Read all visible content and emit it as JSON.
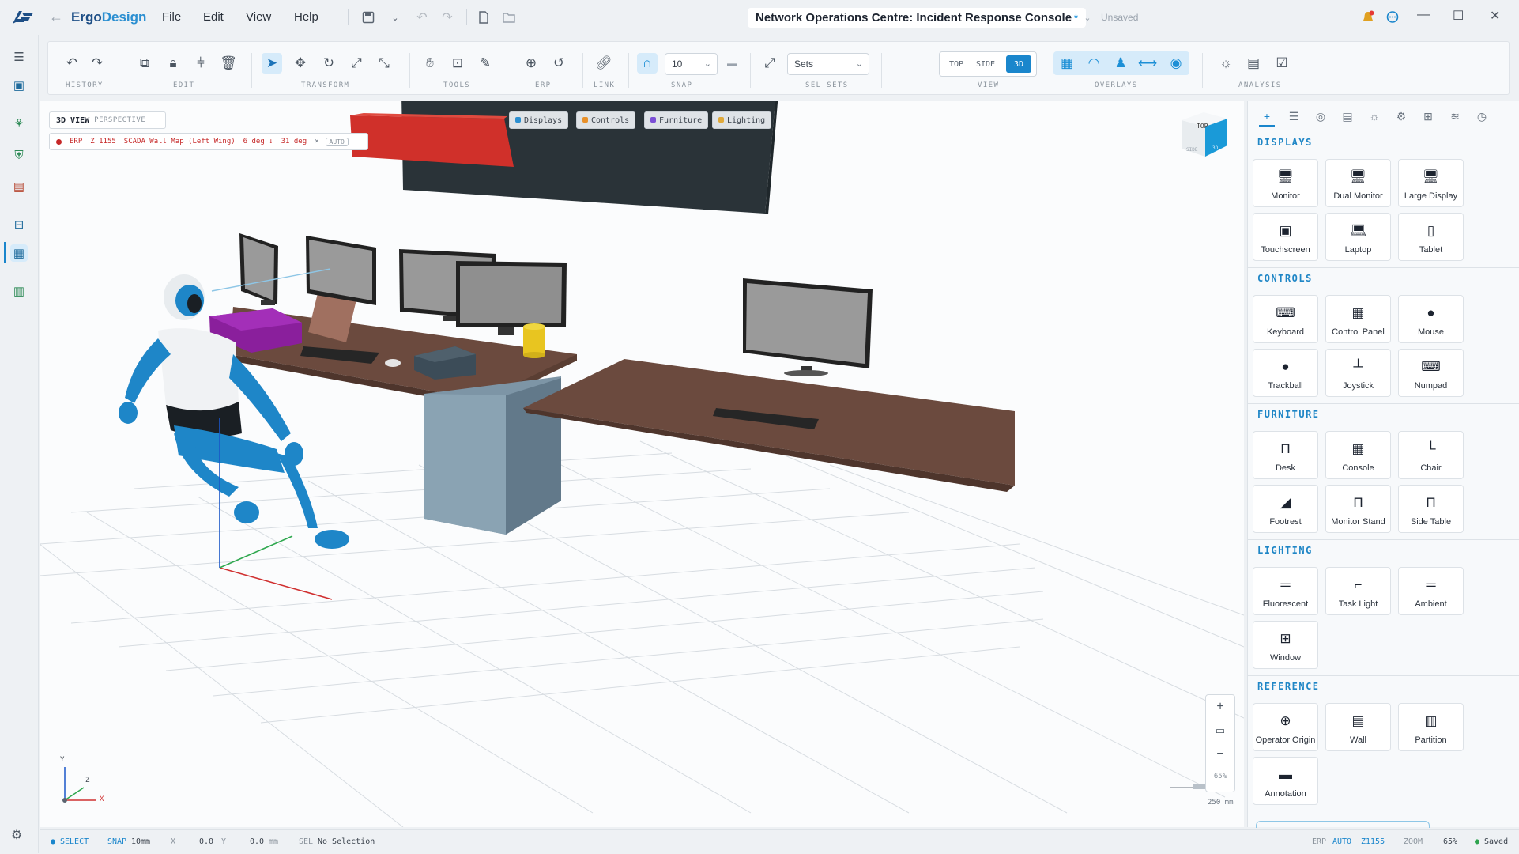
{
  "app": {
    "name_part1": "Ergo",
    "name_part2": "Design"
  },
  "menu": [
    "File",
    "Edit",
    "View",
    "Help"
  ],
  "document": {
    "title": "Network Operations Centre: Incident Response Console",
    "modified_marker": "*",
    "save_state": "Unsaved"
  },
  "toolbar": {
    "groups": [
      "HISTORY",
      "EDIT",
      "TRANSFORM",
      "TOOLS",
      "ERP",
      "LINK",
      "SNAP",
      "SEL SETS",
      "VIEW",
      "OVERLAYS",
      "ANALYSIS"
    ],
    "snap_value": "10",
    "sel_sets_value": "Sets",
    "view_buttons": [
      "TOP",
      "SIDE",
      "3D"
    ],
    "view_selected": "3D"
  },
  "viewport": {
    "mode_label": "3D VIEW",
    "projection": "PERSPECTIVE",
    "erp_label": "ERP",
    "erp_z": "Z 1155",
    "erp_target": "SCADA Wall Map (Left Wing)",
    "erp_angle_down": "6 deg ↓",
    "erp_angle": "31 deg",
    "erp_close": "×",
    "erp_mode": "AUTO",
    "filters": [
      {
        "label": "Displays",
        "color": "#2b8fd1"
      },
      {
        "label": "Controls",
        "color": "#e8902a"
      },
      {
        "label": "Furniture",
        "color": "#7b4fd6"
      },
      {
        "label": "Lighting",
        "color": "#e0a93a"
      }
    ],
    "cube": {
      "top": "TOP",
      "side": "SIDE",
      "front": "3D"
    },
    "axes": {
      "x": "X",
      "y": "Y",
      "z": "Z"
    },
    "zoom": {
      "plus": "+",
      "minus": "−",
      "percent": "65%"
    },
    "scale_label": "250 mm"
  },
  "panel": {
    "sections": [
      {
        "title": "DISPLAYS",
        "items": [
          {
            "label": "Monitor",
            "icon": "🖥"
          },
          {
            "label": "Dual Monitor",
            "icon": "🖥"
          },
          {
            "label": "Large Display",
            "icon": "🖥"
          },
          {
            "label": "Touchscreen",
            "icon": "▣"
          },
          {
            "label": "Laptop",
            "icon": "💻"
          },
          {
            "label": "Tablet",
            "icon": "▯"
          }
        ]
      },
      {
        "title": "CONTROLS",
        "items": [
          {
            "label": "Keyboard",
            "icon": "⌨"
          },
          {
            "label": "Control Panel",
            "icon": "▦"
          },
          {
            "label": "Mouse",
            "icon": "●"
          },
          {
            "label": "Trackball",
            "icon": "●"
          },
          {
            "label": "Joystick",
            "icon": "┴"
          },
          {
            "label": "Numpad",
            "icon": "⌨"
          }
        ]
      },
      {
        "title": "FURNITURE",
        "items": [
          {
            "label": "Desk",
            "icon": "Π"
          },
          {
            "label": "Console",
            "icon": "▦"
          },
          {
            "label": "Chair",
            "icon": "└"
          },
          {
            "label": "Footrest",
            "icon": "◢"
          },
          {
            "label": "Monitor Stand",
            "icon": "Π"
          },
          {
            "label": "Side Table",
            "icon": "Π"
          }
        ]
      },
      {
        "title": "LIGHTING",
        "items": [
          {
            "label": "Fluorescent",
            "icon": "═"
          },
          {
            "label": "Task Light",
            "icon": "⌐"
          },
          {
            "label": "Ambient",
            "icon": "═"
          },
          {
            "label": "Window",
            "icon": "⊞"
          }
        ]
      },
      {
        "title": "REFERENCE",
        "items": [
          {
            "label": "Operator Origin",
            "icon": "⊕"
          },
          {
            "label": "Wall",
            "icon": "▤"
          },
          {
            "label": "Partition",
            "icon": "▥"
          },
          {
            "label": "Annotation",
            "icon": "▬"
          }
        ]
      }
    ]
  },
  "status": {
    "mode": "SELECT",
    "snap_label": "SNAP",
    "snap_value": "10mm",
    "x_label": "X",
    "x_value": "0.0",
    "y_label": "Y",
    "y_value": "0.0",
    "unit": "mm",
    "sel_label": "SEL",
    "sel_value": "No Selection",
    "erp_label": "ERP",
    "erp_mode": "AUTO",
    "erp_z": "Z1155",
    "zoom_label": "ZOOM",
    "zoom_value": "65%",
    "saved": "Saved"
  },
  "colors": {
    "accent": "#1a86cc",
    "brand": "#1e4f86",
    "erp_red": "#c62828",
    "saved_green": "#2ea44f"
  }
}
